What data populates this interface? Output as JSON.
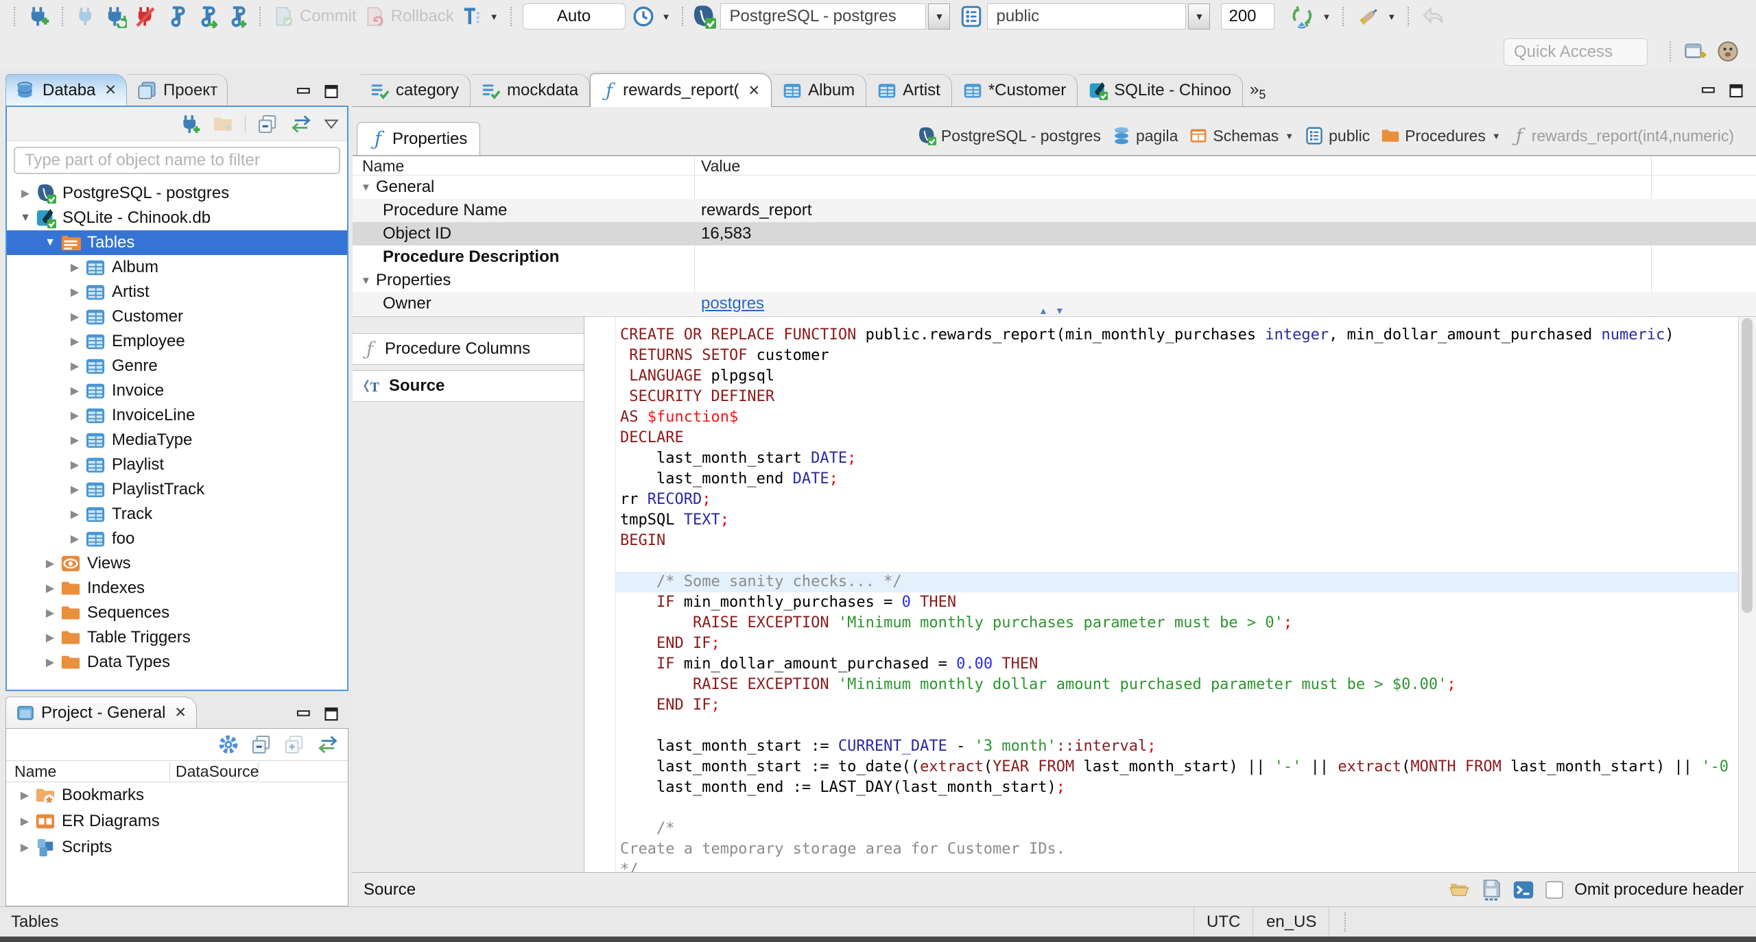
{
  "toolbar": {
    "commit_label": "Commit",
    "rollback_label": "Rollback",
    "auto_commit": "Auto",
    "connection": "PostgreSQL - postgres",
    "schema": "public",
    "fetch_size": "200"
  },
  "quick_access_label": "Quick Access",
  "navigator": {
    "tabs": [
      {
        "label": "Databa"
      },
      {
        "label": "Проект"
      }
    ],
    "filter_placeholder": "Type part of object name to filter",
    "tree": [
      {
        "label": "PostgreSQL - postgres",
        "icon": "pg",
        "level": 0,
        "state": "collapsed"
      },
      {
        "label": "SQLite - Chinook.db",
        "icon": "sqlite",
        "level": 0,
        "state": "expanded"
      },
      {
        "label": "Tables",
        "icon": "tables",
        "level": 1,
        "state": "expanded",
        "selected": true
      },
      {
        "label": "Album",
        "icon": "table",
        "level": 2,
        "state": "collapsed"
      },
      {
        "label": "Artist",
        "icon": "table",
        "level": 2,
        "state": "collapsed"
      },
      {
        "label": "Customer",
        "icon": "table",
        "level": 2,
        "state": "collapsed"
      },
      {
        "label": "Employee",
        "icon": "table",
        "level": 2,
        "state": "collapsed"
      },
      {
        "label": "Genre",
        "icon": "table",
        "level": 2,
        "state": "collapsed"
      },
      {
        "label": "Invoice",
        "icon": "table",
        "level": 2,
        "state": "collapsed"
      },
      {
        "label": "InvoiceLine",
        "icon": "table",
        "level": 2,
        "state": "collapsed"
      },
      {
        "label": "MediaType",
        "icon": "table",
        "level": 2,
        "state": "collapsed"
      },
      {
        "label": "Playlist",
        "icon": "table",
        "level": 2,
        "state": "collapsed"
      },
      {
        "label": "PlaylistTrack",
        "icon": "table",
        "level": 2,
        "state": "collapsed"
      },
      {
        "label": "Track",
        "icon": "table",
        "level": 2,
        "state": "collapsed"
      },
      {
        "label": "foo",
        "icon": "table",
        "level": 2,
        "state": "collapsed"
      },
      {
        "label": "Views",
        "icon": "views",
        "level": 1,
        "state": "collapsed"
      },
      {
        "label": "Indexes",
        "icon": "folder",
        "level": 1,
        "state": "collapsed"
      },
      {
        "label": "Sequences",
        "icon": "folder",
        "level": 1,
        "state": "collapsed"
      },
      {
        "label": "Table Triggers",
        "icon": "folder",
        "level": 1,
        "state": "collapsed"
      },
      {
        "label": "Data Types",
        "icon": "folder",
        "level": 1,
        "state": "collapsed"
      }
    ]
  },
  "project_panel": {
    "title": "Project - General",
    "columns": [
      "Name",
      "DataSource"
    ],
    "tree": [
      {
        "label": "Bookmarks",
        "icon": "bookmarks"
      },
      {
        "label": "ER Diagrams",
        "icon": "er"
      },
      {
        "label": "Scripts",
        "icon": "scripts"
      }
    ]
  },
  "editor_tabs": [
    {
      "label": "category",
      "icon": "mock",
      "active": false,
      "closable": false
    },
    {
      "label": "mockdata",
      "icon": "mock",
      "active": false,
      "closable": false
    },
    {
      "label": "rewards_report(",
      "icon": "func",
      "active": true,
      "closable": true
    },
    {
      "label": "Album",
      "icon": "table",
      "active": false,
      "closable": false
    },
    {
      "label": "Artist",
      "icon": "table",
      "active": false,
      "closable": false
    },
    {
      "label": "*Customer",
      "icon": "table",
      "active": false,
      "closable": false
    },
    {
      "label": "SQLite - Chinoo",
      "icon": "sqlite",
      "active": false,
      "closable": false
    }
  ],
  "tab_overflow": "5",
  "properties_view": {
    "tab_label": "Properties",
    "breadcrumb": [
      {
        "label": "PostgreSQL - postgres",
        "icon": "pg",
        "dropdown": false,
        "dim": false
      },
      {
        "label": "pagila",
        "icon": "dbstack",
        "dropdown": false,
        "dim": false
      },
      {
        "label": "Schemas",
        "icon": "schemas",
        "dropdown": true,
        "dim": false
      },
      {
        "label": "public",
        "icon": "schema",
        "dropdown": false,
        "dim": false
      },
      {
        "label": "Procedures",
        "icon": "folder",
        "dropdown": true,
        "dim": false
      },
      {
        "label": "rewards_report(int4,numeric)",
        "icon": "funcgray",
        "dropdown": false,
        "dim": true
      }
    ],
    "grid": {
      "columns": [
        "Name",
        "Value"
      ],
      "rows": [
        {
          "type": "group",
          "name": "General",
          "value": "",
          "shade": false,
          "selected": false,
          "bold": false,
          "link": false
        },
        {
          "type": "item",
          "name": "Procedure Name",
          "value": "rewards_report",
          "shade": true,
          "selected": false,
          "bold": false,
          "link": false
        },
        {
          "type": "item",
          "name": "Object ID",
          "value": "16,583",
          "shade": false,
          "selected": true,
          "bold": false,
          "link": false
        },
        {
          "type": "item",
          "name": "Procedure Description",
          "value": "",
          "shade": false,
          "selected": false,
          "bold": true,
          "link": false
        },
        {
          "type": "group",
          "name": "Properties",
          "value": "",
          "shade": false,
          "selected": false,
          "bold": false,
          "link": false
        },
        {
          "type": "item",
          "name": "Owner",
          "value": "postgres",
          "shade": true,
          "selected": false,
          "bold": false,
          "link": true
        }
      ]
    },
    "side_tabs": [
      {
        "label": "Procedure Columns",
        "icon": "funcgray",
        "selected": false
      },
      {
        "label": "Source",
        "icon": "src",
        "selected": true
      }
    ]
  },
  "code": {
    "lines": [
      {
        "hl": false,
        "tokens": [
          [
            "kw",
            "CREATE OR REPLACE FUNCTION "
          ],
          [
            "pln",
            "public.rewards_report(min_monthly_purchases "
          ],
          [
            "typ",
            "integer"
          ],
          [
            "pln",
            ", min_dollar_amount_purchased "
          ],
          [
            "typ",
            "numeric"
          ],
          [
            "pln",
            ")"
          ]
        ]
      },
      {
        "hl": false,
        "tokens": [
          [
            "pln",
            " "
          ],
          [
            "kw",
            "RETURNS SETOF"
          ],
          [
            "pln",
            " customer"
          ]
        ]
      },
      {
        "hl": false,
        "tokens": [
          [
            "pln",
            " "
          ],
          [
            "kw",
            "LANGUAGE"
          ],
          [
            "pln",
            " plpgsql"
          ]
        ]
      },
      {
        "hl": false,
        "tokens": [
          [
            "pln",
            " "
          ],
          [
            "kw",
            "SECURITY DEFINER"
          ]
        ]
      },
      {
        "hl": false,
        "tokens": [
          [
            "kw",
            "AS "
          ],
          [
            "red",
            "$function$"
          ]
        ]
      },
      {
        "hl": false,
        "tokens": [
          [
            "kw",
            "DECLARE"
          ]
        ]
      },
      {
        "hl": false,
        "tokens": [
          [
            "pln",
            "    last_month_start "
          ],
          [
            "typ",
            "DATE"
          ],
          [
            "semi",
            ";"
          ]
        ]
      },
      {
        "hl": false,
        "tokens": [
          [
            "pln",
            "    last_month_end "
          ],
          [
            "typ",
            "DATE"
          ],
          [
            "semi",
            ";"
          ]
        ]
      },
      {
        "hl": false,
        "tokens": [
          [
            "pln",
            "rr "
          ],
          [
            "typ",
            "RECORD"
          ],
          [
            "semi",
            ";"
          ]
        ]
      },
      {
        "hl": false,
        "tokens": [
          [
            "pln",
            "tmpSQL "
          ],
          [
            "typ",
            "TEXT"
          ],
          [
            "semi",
            ";"
          ]
        ]
      },
      {
        "hl": false,
        "tokens": [
          [
            "kw",
            "BEGIN"
          ]
        ]
      },
      {
        "hl": false,
        "tokens": []
      },
      {
        "hl": true,
        "tokens": [
          [
            "com",
            "    /* Some sanity checks... */"
          ]
        ]
      },
      {
        "hl": false,
        "tokens": [
          [
            "pln",
            "    "
          ],
          [
            "kw",
            "IF"
          ],
          [
            "pln",
            " min_monthly_purchases = "
          ],
          [
            "num",
            "0"
          ],
          [
            "pln",
            " "
          ],
          [
            "kw",
            "THEN"
          ]
        ]
      },
      {
        "hl": false,
        "tokens": [
          [
            "pln",
            "        "
          ],
          [
            "kw",
            "RAISE EXCEPTION "
          ],
          [
            "str",
            "'Minimum monthly purchases parameter must be > 0'"
          ],
          [
            "semi",
            ";"
          ]
        ]
      },
      {
        "hl": false,
        "tokens": [
          [
            "pln",
            "    "
          ],
          [
            "kw",
            "END IF"
          ],
          [
            "semi",
            ";"
          ]
        ]
      },
      {
        "hl": false,
        "tokens": [
          [
            "pln",
            "    "
          ],
          [
            "kw",
            "IF"
          ],
          [
            "pln",
            " min_dollar_amount_purchased = "
          ],
          [
            "num",
            "0.00"
          ],
          [
            "pln",
            " "
          ],
          [
            "kw",
            "THEN"
          ]
        ]
      },
      {
        "hl": false,
        "tokens": [
          [
            "pln",
            "        "
          ],
          [
            "kw",
            "RAISE EXCEPTION "
          ],
          [
            "str",
            "'Minimum monthly dollar amount purchased parameter must be > $0.00'"
          ],
          [
            "semi",
            ";"
          ]
        ]
      },
      {
        "hl": false,
        "tokens": [
          [
            "pln",
            "    "
          ],
          [
            "kw",
            "END IF"
          ],
          [
            "semi",
            ";"
          ]
        ]
      },
      {
        "hl": false,
        "tokens": []
      },
      {
        "hl": false,
        "tokens": [
          [
            "pln",
            "    last_month_start := "
          ],
          [
            "typ",
            "CURRENT_DATE"
          ],
          [
            "pln",
            " - "
          ],
          [
            "str",
            "'3 month'"
          ],
          [
            "kw",
            "::interval"
          ],
          [
            "semi",
            ";"
          ]
        ]
      },
      {
        "hl": false,
        "tokens": [
          [
            "pln",
            "    last_month_start := to_date(("
          ],
          [
            "kw",
            "extract"
          ],
          [
            "pln",
            "("
          ],
          [
            "kw",
            "YEAR FROM"
          ],
          [
            "pln",
            " last_month_start) || "
          ],
          [
            "str",
            "'-'"
          ],
          [
            "pln",
            " || "
          ],
          [
            "kw",
            "extract"
          ],
          [
            "pln",
            "("
          ],
          [
            "kw",
            "MONTH FROM"
          ],
          [
            "pln",
            " last_month_start) || "
          ],
          [
            "str",
            "'-0"
          ]
        ]
      },
      {
        "hl": false,
        "tokens": [
          [
            "pln",
            "    last_month_end := LAST_DAY(last_month_start)"
          ],
          [
            "semi",
            ";"
          ]
        ]
      },
      {
        "hl": false,
        "tokens": []
      },
      {
        "hl": false,
        "tokens": [
          [
            "com",
            "    /*"
          ]
        ]
      },
      {
        "hl": false,
        "tokens": [
          [
            "com",
            "Create a temporary storage area for Customer IDs."
          ]
        ]
      },
      {
        "hl": false,
        "tokens": [
          [
            "com",
            "*/"
          ]
        ]
      }
    ]
  },
  "editor_footer": {
    "label": "Source",
    "checkbox_label": "Omit procedure header"
  },
  "statusbar": {
    "left": "Tables",
    "timezone": "UTC",
    "locale": "en_US"
  }
}
